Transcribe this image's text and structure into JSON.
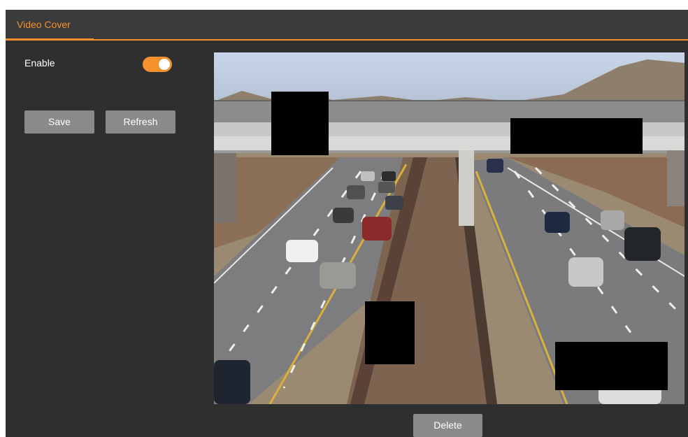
{
  "tabs": [
    {
      "label": "Video Cover",
      "active": true
    }
  ],
  "settings": {
    "enable_label": "Enable",
    "enable_on": true
  },
  "buttons": {
    "save": "Save",
    "refresh": "Refresh",
    "delete": "Delete"
  },
  "video": {
    "cover_areas_count": 4
  },
  "colors": {
    "accent": "#f4912d",
    "panel_bg": "#2f2f2f",
    "tabbar_bg": "#3b3b3b",
    "button_bg": "#8a8a8a",
    "mask": "#000000"
  }
}
